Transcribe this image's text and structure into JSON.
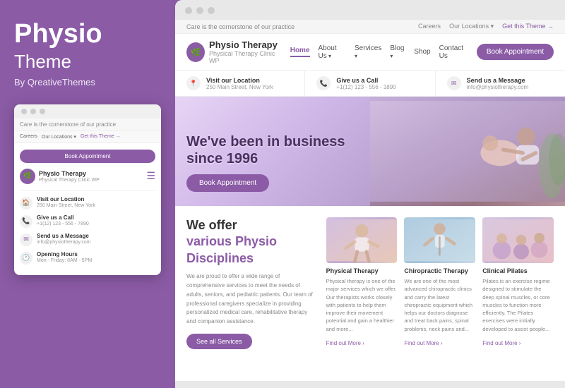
{
  "left": {
    "title_bold": "Physio",
    "title_light": "Theme",
    "by": "By QreativeThemes",
    "mini_browser": {
      "topbar_text": "Care is the cornerstone of our practice",
      "nav_links": [
        "Careers",
        "Our Locations ▾",
        "Get this Theme →"
      ],
      "book_btn": "Book Appointment",
      "logo": {
        "name": "Physio Therapy",
        "sub": "Physical Therapy Clinic WP",
        "icon": "🌿"
      },
      "info_items": [
        {
          "icon": "🏠",
          "label": "Visit our Location",
          "sub": "250 Main Street, New York"
        },
        {
          "icon": "📞",
          "label": "Give us a Call",
          "sub": "+1(12) 123 - 556 - 7890"
        },
        {
          "icon": "✉",
          "label": "Send us a Message",
          "sub": "info@physiotherapy.com"
        },
        {
          "icon": "🕐",
          "label": "Opening Hours",
          "sub": "Mon - Friday: 8AM - 5PM"
        }
      ]
    }
  },
  "right": {
    "topbar": {
      "text": "Care is the cornerstone of our practice",
      "links": [
        "Careers",
        "Our Locations ▾",
        "Get this Theme →"
      ]
    },
    "navbar": {
      "logo_name": "Physio Therapy",
      "logo_sub": "Physical Therapy Clinic WP",
      "logo_icon": "🌿",
      "nav_links": [
        {
          "label": "Home",
          "active": true
        },
        {
          "label": "About Us",
          "has_arrow": true
        },
        {
          "label": "Services",
          "has_arrow": true
        },
        {
          "label": "Blog",
          "has_arrow": true
        },
        {
          "label": "Shop"
        },
        {
          "label": "Contact Us"
        }
      ],
      "book_btn": "Book Appointment"
    },
    "info_bar": [
      {
        "icon": "📍",
        "label": "Visit our Location",
        "val": "250 Main Street, New York"
      },
      {
        "icon": "📞",
        "label": "Give us a Call",
        "val": "+1(12) 123 - 556 - 1890"
      },
      {
        "icon": "✉",
        "label": "Send us a Message",
        "val": "info@physiotherapy.com"
      }
    ],
    "hero": {
      "headline_line1": "We've been in business",
      "headline_line2": "since 1996",
      "book_btn": "Book Appointment"
    },
    "offer": {
      "title_line1": "We offer",
      "title_line2": "various Physio",
      "title_line3": "Disciplines",
      "text": "We are proud to offer a wide range of comprehensive services to meet the needs of adults, seniors, and pediatric patients. Our team of professional caregivers specialize in providing personalized medical care, rehabilitative therapy and companion assistance.",
      "see_btn": "See all Services"
    },
    "cards": [
      {
        "title": "Physical Therapy",
        "text": "Physical therapy is one of the major services which we offer. Our therapists works closely with patients to help them improve their movement potential and gain a healthier and more...",
        "link": "Find out More"
      },
      {
        "title": "Chiropractic Therapy",
        "text": "We are one of the most advanced chiropractic clinics and carry the latest chiropractic equipment which helps our doctors diagnose and treat back pains, spinal problems, neck pains and...",
        "link": "Find out More"
      },
      {
        "title": "Clinical Pilates",
        "text": "Pilates is an exercise regime designed to stimulate the deep spinal muscles, or core muscles to function more efficiently. The Pilates exercises were initially developed to assist people...",
        "link": "Find out More"
      }
    ]
  }
}
